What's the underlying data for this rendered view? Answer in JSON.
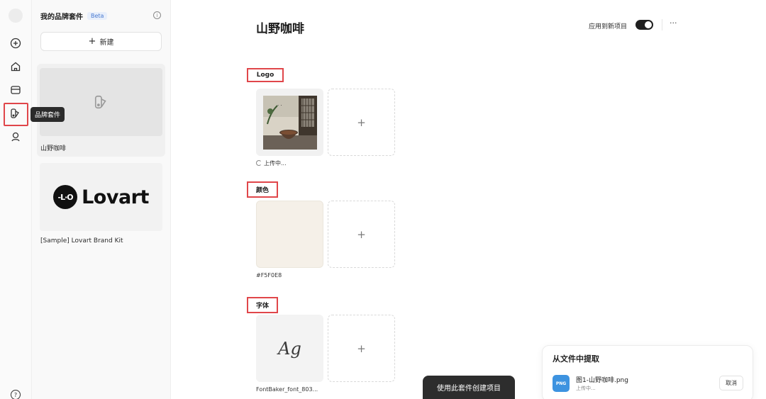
{
  "rail": {
    "items": [
      "plus-icon",
      "home-icon",
      "folder-icon",
      "brand-kit-icon",
      "user-icon"
    ],
    "tooltip": "品牌套件",
    "help": "?"
  },
  "panel": {
    "title": "我的品牌套件",
    "badge": "Beta",
    "info": "i",
    "new_plus": "+",
    "new_label": "新建",
    "kits": [
      {
        "name": "山野咖啡"
      },
      {
        "name": "[Sample] Lovart Brand Kit",
        "logo_mark": "-L·O",
        "logo_text": "Lovart"
      }
    ]
  },
  "main": {
    "title": "山野咖啡",
    "apply_label": "应用到新项目",
    "apply_on": true,
    "more": "···",
    "sections": {
      "logo": {
        "label": "Logo",
        "caption": "上传中..."
      },
      "color": {
        "label": "颜色",
        "caption": "#F5F0E8",
        "swatch": "#F5F0E8"
      },
      "font": {
        "label": "字体",
        "sample": "Ag",
        "caption": "FontBaker_font_803..."
      }
    },
    "add": "+"
  },
  "cta": {
    "label": "使用此套件创建项目"
  },
  "extract": {
    "title": "从文件中提取",
    "badge": "PNG",
    "file_name": "图1-山野咖啡.png",
    "status": "上传中...",
    "cancel": "取消"
  },
  "colors": {
    "accent": "#E0464A",
    "dark": "#2D2D2D",
    "png_blue": "#3D93E0"
  }
}
